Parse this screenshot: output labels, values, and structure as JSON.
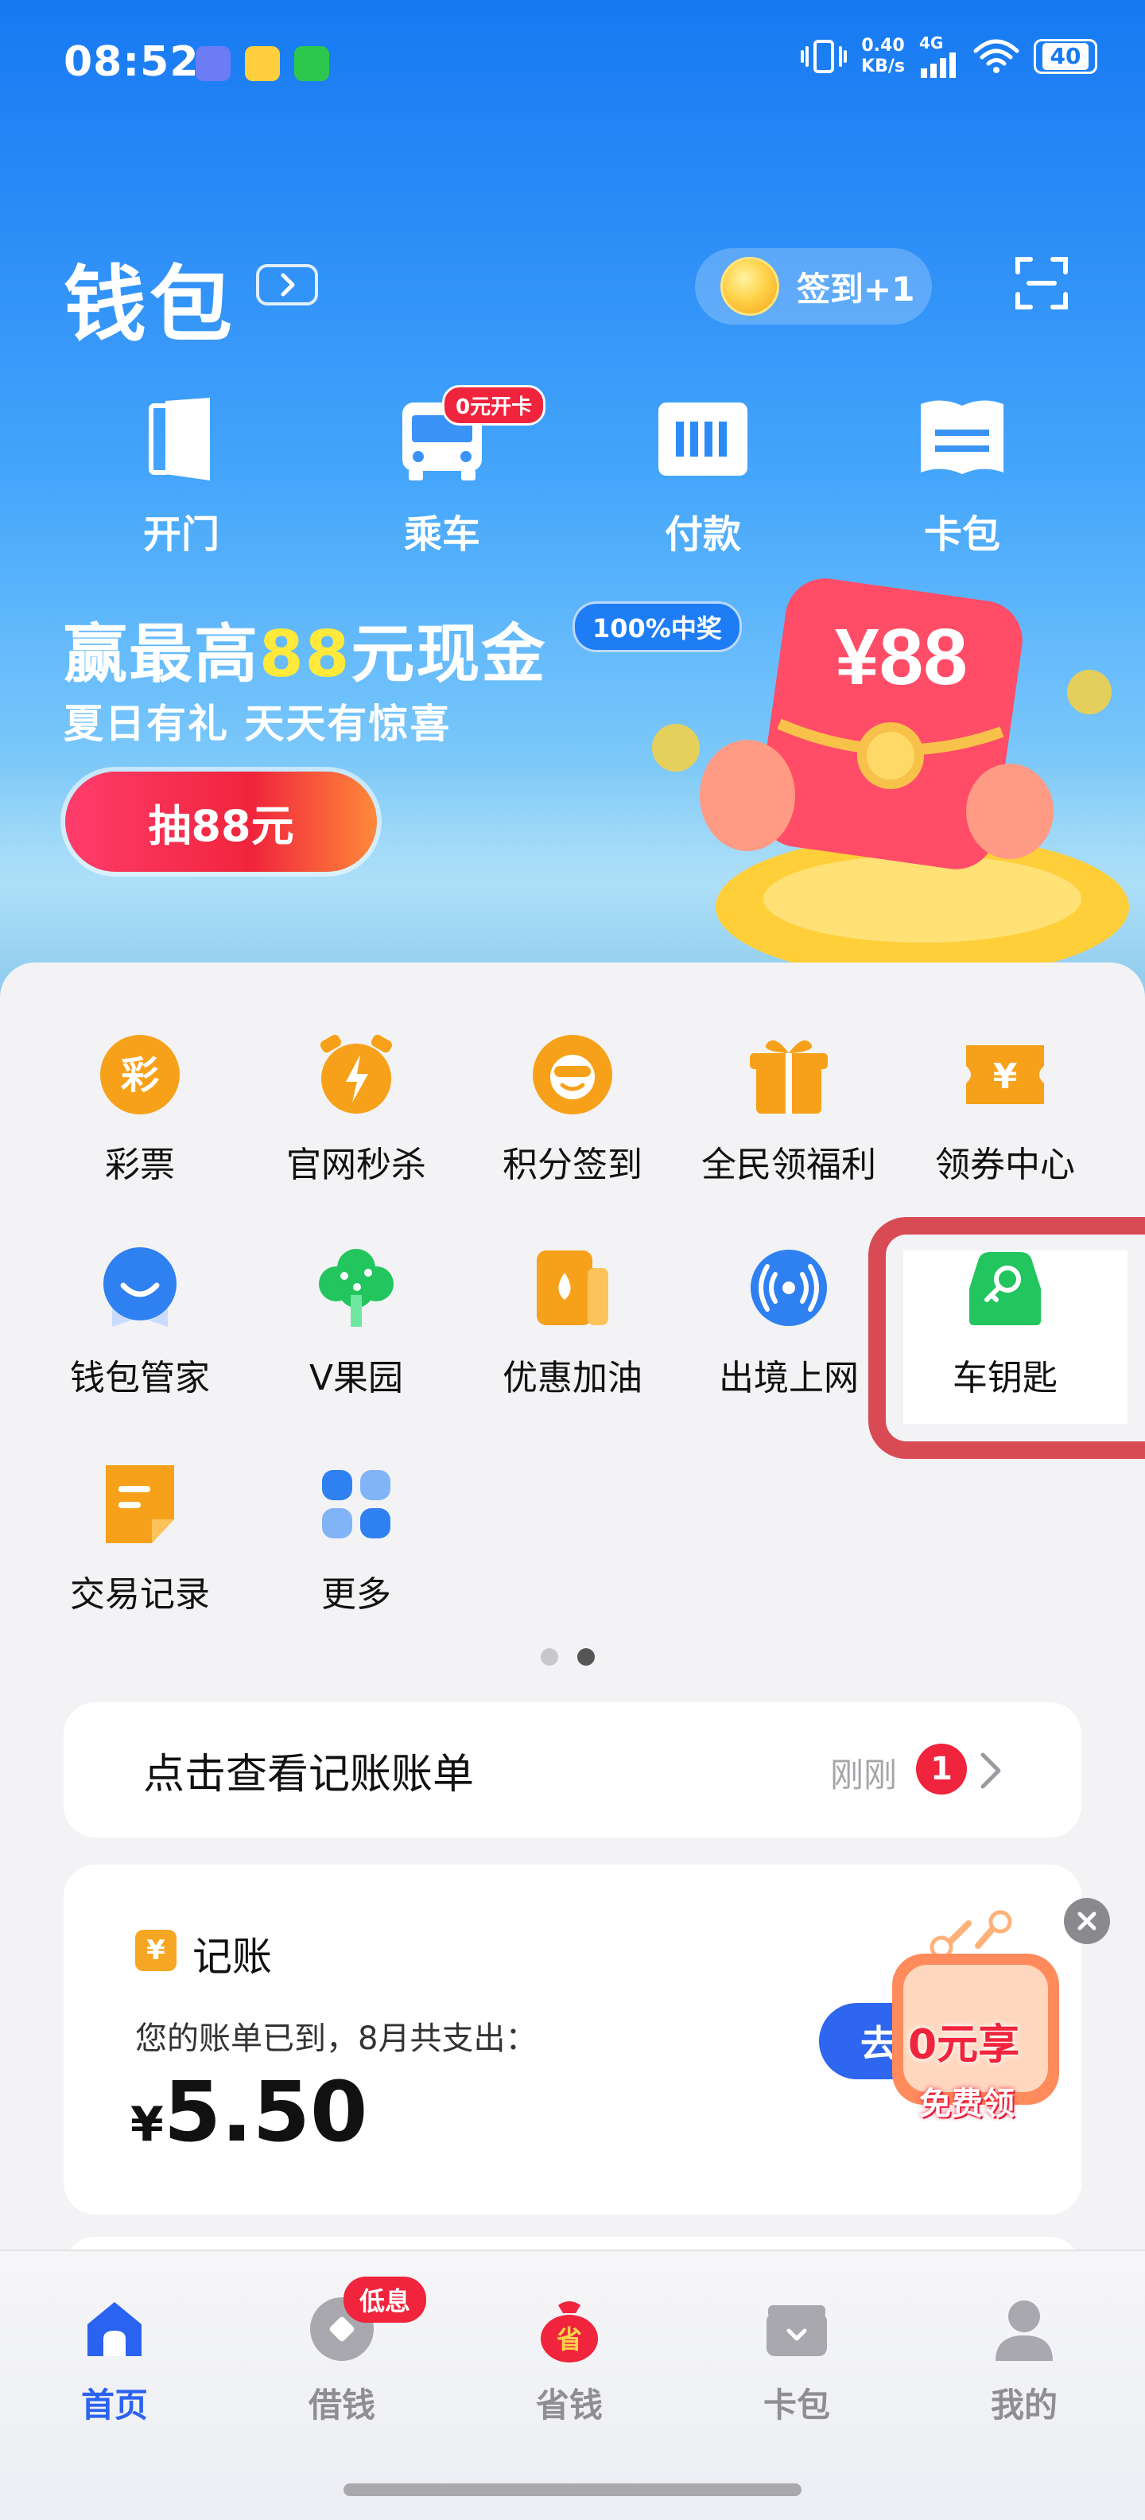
{
  "status_bar": {
    "time": "08:52",
    "net_speed_value": "0.40",
    "net_speed_unit": "KB/s",
    "network": "4G",
    "battery": "40"
  },
  "header": {
    "title": "钱包",
    "checkin_label": "签到+1"
  },
  "quick_actions": [
    {
      "label": "开门",
      "icon": "door-icon"
    },
    {
      "label": "乘车",
      "icon": "bus-icon",
      "badge": "0元开卡"
    },
    {
      "label": "付款",
      "icon": "barcode-icon"
    },
    {
      "label": "卡包",
      "icon": "card-book-icon"
    }
  ],
  "banner": {
    "title_part1": "赢最高",
    "title_highlight": "88",
    "title_part2": "元现金",
    "tag": "100%中奖",
    "subtitle": "夏日有礼 天天有惊喜",
    "button": "抽88元",
    "envelope_text": "¥88"
  },
  "services": [
    {
      "label": "彩票",
      "icon": "lottery-icon"
    },
    {
      "label": "官网秒杀",
      "icon": "alarm-flash-icon"
    },
    {
      "label": "积分签到",
      "icon": "points-checkin-icon"
    },
    {
      "label": "全民领福利",
      "icon": "gift-icon"
    },
    {
      "label": "领券中心",
      "icon": "coupon-icon"
    },
    {
      "label": "钱包管家",
      "icon": "wallet-butler-icon"
    },
    {
      "label": "V果园",
      "icon": "tree-icon"
    },
    {
      "label": "优惠加油",
      "icon": "fuel-icon"
    },
    {
      "label": "出境上网",
      "icon": "signal-icon"
    },
    {
      "label": "车钥匙",
      "icon": "car-key-icon"
    },
    {
      "label": "交易记录",
      "icon": "transaction-record-icon"
    },
    {
      "label": "更多",
      "icon": "more-grid-icon"
    }
  ],
  "bill_card": {
    "title": "点击查看记账账单",
    "time": "刚刚",
    "badge": "1"
  },
  "ledger_card": {
    "icon_text": "¥",
    "title": "记账",
    "desc": "您的账单已到，8月共支出：",
    "currency": "¥",
    "amount": "5.50",
    "go_button": "去",
    "promo_title": "0元享",
    "promo_sub": "免费领"
  },
  "bottom_nav": [
    {
      "label": "首页",
      "icon": "home-icon",
      "active": true
    },
    {
      "label": "借钱",
      "icon": "borrow-icon",
      "active": false,
      "badge": "低息"
    },
    {
      "label": "省钱",
      "icon": "save-money-bag-icon",
      "active": false
    },
    {
      "label": "卡包",
      "icon": "wallet-icon",
      "active": false
    },
    {
      "label": "我的",
      "icon": "profile-icon",
      "active": false
    }
  ],
  "colors": {
    "brand_blue": "#1779f2",
    "accent_red": "#f0243c",
    "icon_orange": "#f7a11a",
    "icon_green": "#22c55e",
    "icon_blue": "#2f80f0",
    "highlight_red": "#d84b55",
    "active_nav": "#2a63f0"
  }
}
